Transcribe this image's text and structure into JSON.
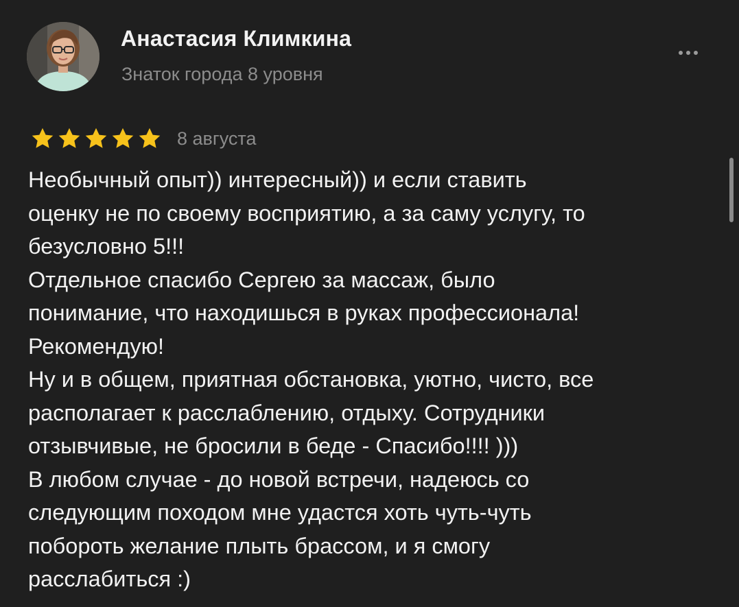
{
  "review": {
    "author": {
      "name": "Анастасия Климкина",
      "level": "Знаток города 8 уровня",
      "avatar_icon": "user-photo-avatar"
    },
    "more_icon": "more-horizontal-icon",
    "rating": {
      "stars": 5,
      "max_stars": 5,
      "star_color": "#f7c21b"
    },
    "date": "8 августа",
    "text_lines": [
      "Необычный опыт)) интересный)) и если ставить",
      "оценку не по своему восприятию, а за саму услугу, то",
      "безусловно 5!!!",
      "Отдельное спасибо Сергею за массаж, было",
      "понимание, что находишься в руках профессионала!",
      "Рекомендую!",
      "Ну и в общем, приятная обстановка, уютно, чисто, все",
      "располагает к расслаблению, отдыху. Сотрудники",
      "отзывчивые, не бросили в беде - Спасибо!!!! )))",
      "В любом случае - до новой встречи, надеюсь со",
      "следующим походом мне удастся хоть чуть-чуть",
      "побороть желание плыть брассом, и я смогу",
      "расслабиться :)"
    ]
  },
  "colors": {
    "background": "#1f1f1f",
    "text_primary": "#f2f2f2",
    "text_secondary": "#8c8c8c",
    "star": "#f7c21b"
  }
}
